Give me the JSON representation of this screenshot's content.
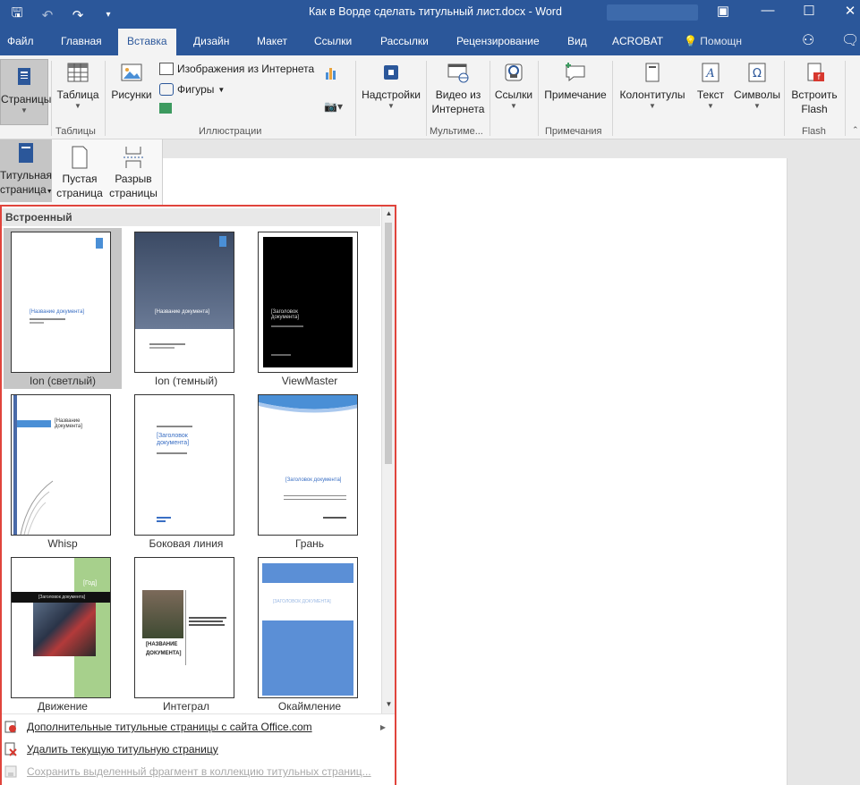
{
  "titlebar": {
    "title": "Как в Ворде сделать титульный лист.docx - Word",
    "bg_color": "#2b579a"
  },
  "tabs": [
    {
      "label": "Файл",
      "active": false
    },
    {
      "label": "Главная",
      "active": false
    },
    {
      "label": "Вставка",
      "active": true
    },
    {
      "label": "Дизайн",
      "active": false
    },
    {
      "label": "Макет",
      "active": false
    },
    {
      "label": "Ссылки",
      "active": false
    },
    {
      "label": "Рассылки",
      "active": false
    },
    {
      "label": "Рецензирование",
      "active": false
    },
    {
      "label": "Вид",
      "active": false
    },
    {
      "label": "ACROBAT",
      "active": false
    },
    {
      "label": "Помощн",
      "active": false
    }
  ],
  "ribbon": {
    "pages_label": "Страницы",
    "table_label": "Таблица",
    "tables_group": "Таблицы",
    "pictures_label": "Рисунки",
    "online_images_label": "Изображения из Интернета",
    "shapes_label": "Фигуры",
    "illustrations_group": "Иллюстрации",
    "addins_label": "Надстройки",
    "video_label_1": "Видео из",
    "video_label_2": "Интернета",
    "multimedia_group": "Мультиме...",
    "links_label": "Ссылки",
    "comment_label": "Примечание",
    "comments_group": "Примечания",
    "header_footer_label": "Колонтитулы",
    "text_label": "Текст",
    "symbols_label": "Символы",
    "flash_label_1": "Встроить",
    "flash_label_2": "Flash",
    "flash_group": "Flash"
  },
  "subpanel": {
    "cover_1": "Титульная",
    "cover_2": "страница",
    "blank_1": "Пустая",
    "blank_2": "страница",
    "break_1": "Разрыв",
    "break_2": "страницы"
  },
  "gallery": {
    "header": "Встроенный",
    "items": [
      {
        "caption": "Ion (светлый)",
        "title_text": "[Название документа]",
        "selected": true
      },
      {
        "caption": "Ion (темный)",
        "title_text": "[Название документа]",
        "selected": false
      },
      {
        "caption": "ViewMaster",
        "title_text": "[Заголовок документа]",
        "selected": false
      },
      {
        "caption": "Whisp",
        "title_text": "[Название документа]",
        "selected": false
      },
      {
        "caption": "Боковая линия",
        "title_text": "[Заголовок документа]",
        "selected": false
      },
      {
        "caption": "Грань",
        "title_text": "[Заголовок документа]",
        "selected": false
      },
      {
        "caption": "Движение",
        "title_text": "[Заголовок документа]",
        "year_text": "[Год]",
        "selected": false
      },
      {
        "caption": "Интеграл",
        "title_text": "[НАЗВАНИЕ ДОКУМЕНТА]",
        "selected": false
      },
      {
        "caption": "Окаймление",
        "title_text": "[ЗАГОЛОВОК ДОКУМЕНТА]",
        "selected": false
      }
    ],
    "footer": {
      "more_label": "Дополнительные титульные страницы с сайта Office.com",
      "remove_label": "Удалить текущую титульную страницу",
      "save_label": "Сохранить выделенный фрагмент в коллекцию титульных страниц..."
    }
  },
  "colors": {
    "accent_blue": "#2b579a",
    "highlight_red": "#e0443c",
    "selection_gray": "#c6c6c6"
  }
}
